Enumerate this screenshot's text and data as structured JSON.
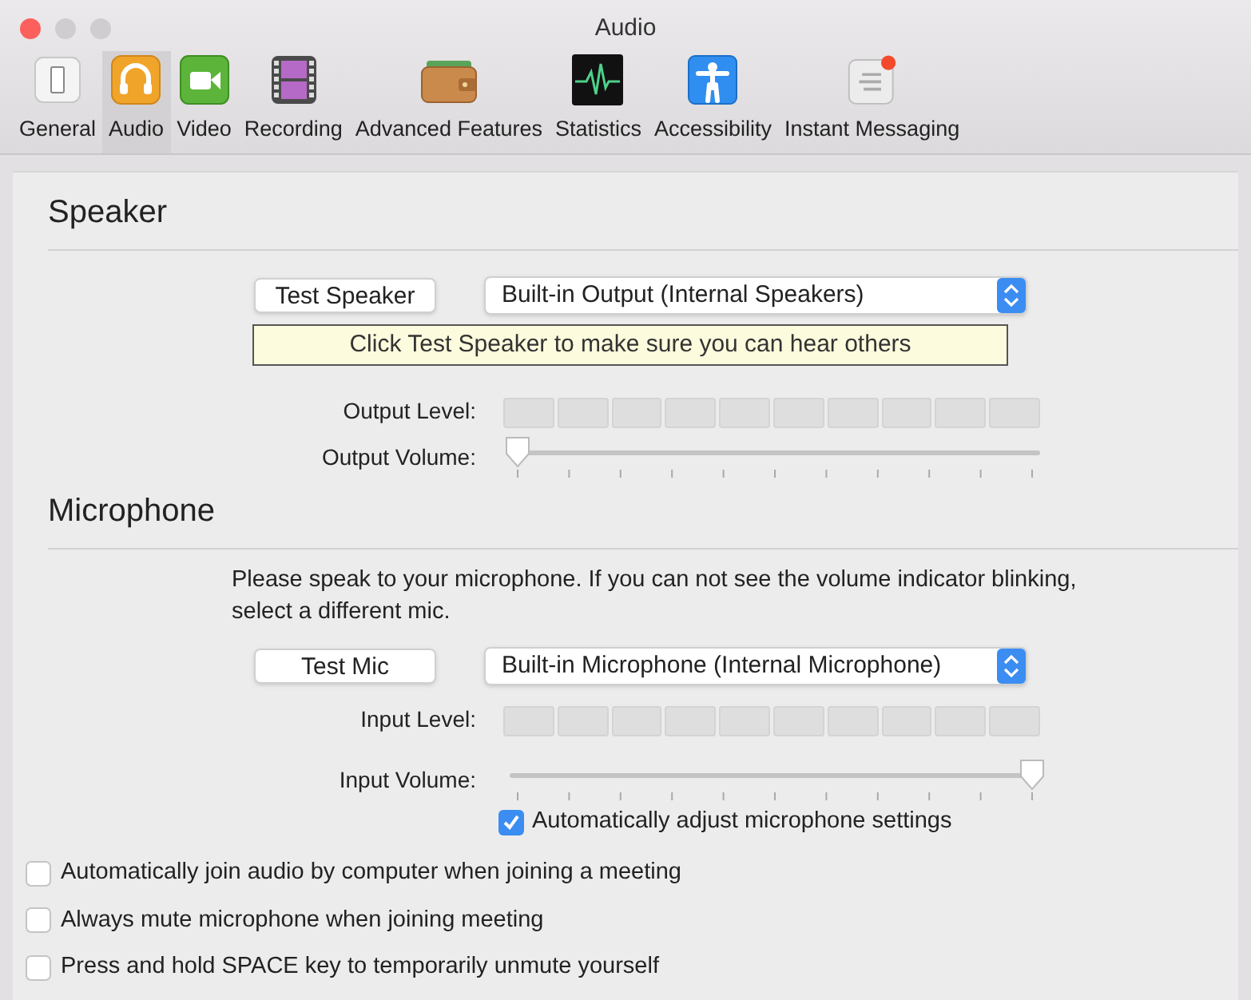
{
  "window": {
    "title": "Audio"
  },
  "tabs": [
    {
      "label": "General",
      "kind": "general",
      "selected": false
    },
    {
      "label": "Audio",
      "kind": "audio",
      "selected": true
    },
    {
      "label": "Video",
      "kind": "video",
      "selected": false
    },
    {
      "label": "Recording",
      "kind": "recording",
      "selected": false
    },
    {
      "label": "Advanced Features",
      "kind": "advanced",
      "selected": false
    },
    {
      "label": "Statistics",
      "kind": "statistics",
      "selected": false
    },
    {
      "label": "Accessibility",
      "kind": "accessibility",
      "selected": false
    },
    {
      "label": "Instant Messaging",
      "kind": "messaging",
      "selected": false
    }
  ],
  "speaker": {
    "heading": "Speaker",
    "test_button": "Test Speaker",
    "device": "Built-in Output (Internal Speakers)",
    "tooltip": "Click Test Speaker to make sure you can hear others",
    "output_level": {
      "label": "Output Level:"
    },
    "output_volume": {
      "label": "Output Volume:",
      "level": 0
    }
  },
  "microphone": {
    "heading": "Microphone",
    "hint": "Please speak to your microphone. If you can not see the volume indicator blinking, select a different mic.",
    "test_button": "Test Mic",
    "device": "Built-in Microphone (Internal Microphone)",
    "input_level": {
      "label": "Input Level:"
    },
    "input_volume": {
      "label": "Input Volume:",
      "level": 1
    },
    "auto_adjust": {
      "label": "Automatically adjust microphone settings",
      "checked": true
    }
  },
  "options": [
    {
      "label": "Automatically join audio by computer when joining a meeting",
      "checked": false
    },
    {
      "label": "Always mute microphone when joining meeting",
      "checked": false
    },
    {
      "label": "Press and hold SPACE key to temporarily unmute yourself",
      "checked": false
    }
  ]
}
